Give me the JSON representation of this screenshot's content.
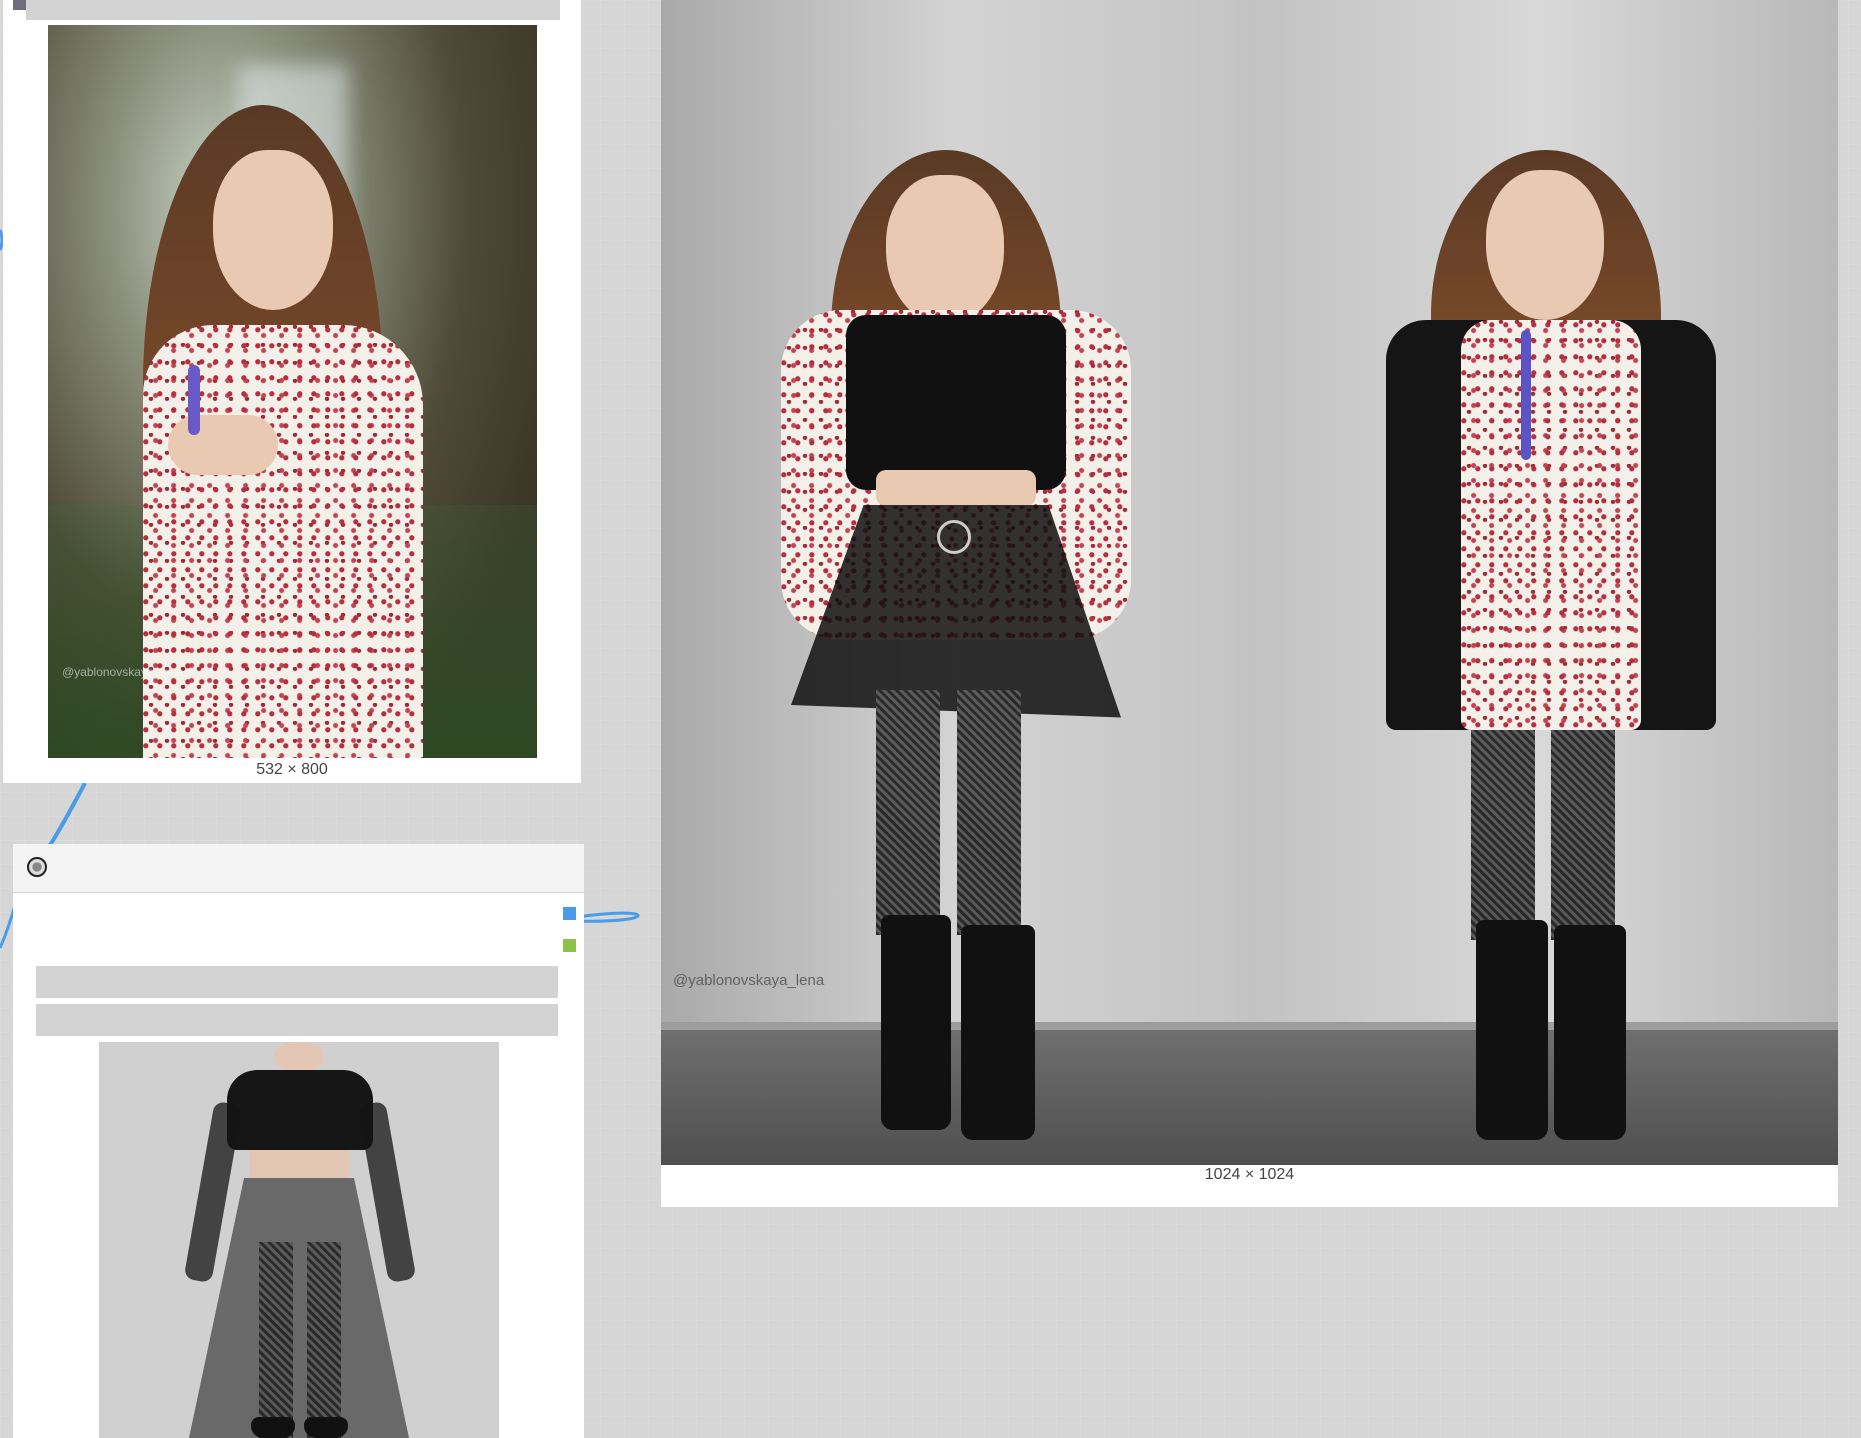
{
  "canvas": {
    "background": "#d6d6d6",
    "wire_color": "#4a9ce8"
  },
  "node_reference_photo": {
    "size_label": "532 × 800",
    "watermark": "@yablonovskaya_lena"
  },
  "node_loader": {
    "toggle_icon": "toggle-icon",
    "ports": [
      {
        "icon": "output-port-blue-icon",
        "color": "#4a9ce8"
      },
      {
        "icon": "output-port-green-icon",
        "color": "#8bc34a"
      }
    ]
  },
  "node_result": {
    "size_label": "1024 × 1024",
    "watermark": "@yablonovskaya_lena"
  }
}
